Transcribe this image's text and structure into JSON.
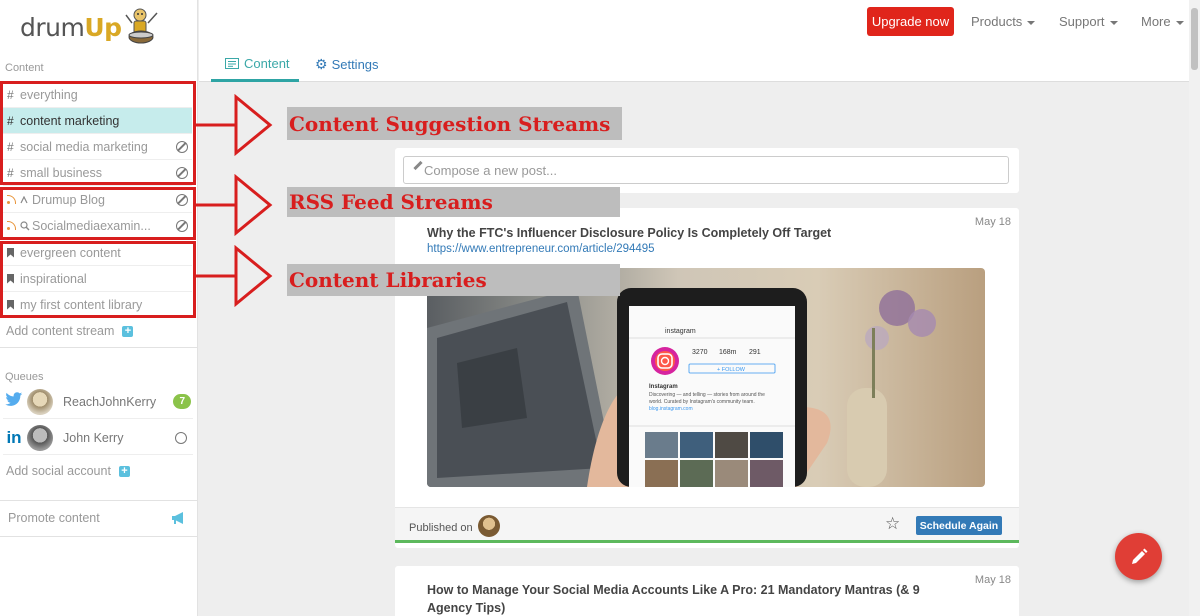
{
  "logo": {
    "text_a": "drum",
    "text_b": "Up"
  },
  "sidebar": {
    "content_label": "Content",
    "streams": [
      {
        "label": "everything",
        "icon": "hash-icon"
      },
      {
        "label": "content marketing",
        "icon": "hash-icon",
        "active": true
      },
      {
        "label": "social media marketing",
        "icon": "hash-icon",
        "blocked": true
      },
      {
        "label": "small business",
        "icon": "hash-icon",
        "blocked": true
      }
    ],
    "rss": [
      {
        "label": "Drumup Blog",
        "blocked": true
      },
      {
        "label": "Socialmediaexamin...",
        "blocked": true
      }
    ],
    "libraries": [
      {
        "label": "evergreen content"
      },
      {
        "label": "inspirational"
      },
      {
        "label": "my first content library"
      }
    ],
    "add_stream": "Add content stream",
    "queues_label": "Queues",
    "queues": [
      {
        "network": "twitter",
        "name": "ReachJohnKerry",
        "badge": "7"
      },
      {
        "network": "linkedin",
        "name": "John Kerry",
        "blocked": true
      }
    ],
    "add_social": "Add social account",
    "promote": "Promote content"
  },
  "nav": {
    "upgrade": "Upgrade now",
    "products": "Products",
    "support": "Support",
    "more": "More"
  },
  "tabs": {
    "content": "Content",
    "settings": "Settings"
  },
  "compose": {
    "placeholder": "Compose a new post..."
  },
  "posts": [
    {
      "date": "May 18",
      "title": "Why the FTC's Influencer Disclosure Policy Is Completely Off Target",
      "link": "https://www.entrepreneur.com/article/294495",
      "published_on": "Published on",
      "schedule": "Schedule Again",
      "phone_stats": [
        "3270",
        "168m",
        "291"
      ],
      "phone_header": "instagram",
      "phone_follow": "+ FOLLOW",
      "phone_bio_title": "Instagram",
      "phone_bio_lines": [
        "Discovering — and telling — stories from around the",
        "world. Curated by Instagram's community team.",
        "blog.instagram.com"
      ]
    },
    {
      "date": "May 18",
      "title": "How to Manage Your Social Media Accounts Like A Pro: 21 Mandatory Mantras (& 9 Agency Tips)"
    }
  ],
  "annotations": {
    "streams": "Content Suggestion Streams",
    "rss": "RSS Feed Streams",
    "libraries": "Content Libraries"
  },
  "colors": {
    "accent": "#2ea4a4",
    "upgrade": "#e0251b",
    "annotation_red": "#d81e1e",
    "active_bg": "#c6ecec"
  }
}
